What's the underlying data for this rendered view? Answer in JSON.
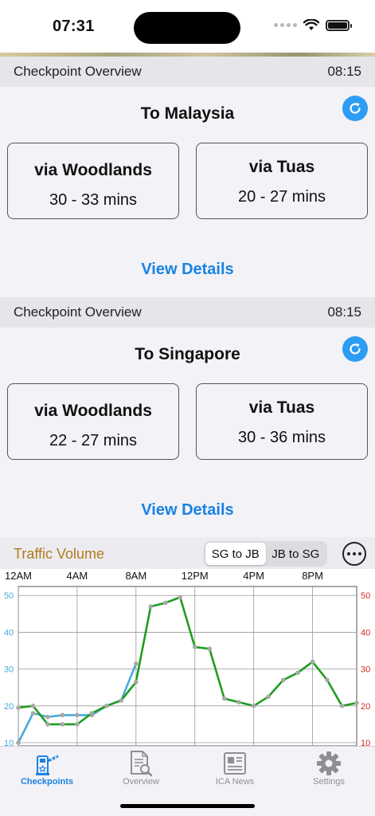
{
  "status": {
    "time": "07:31"
  },
  "to_malaysia": {
    "header_label": "Checkpoint Overview",
    "header_time": "08:15",
    "title": "To Malaysia",
    "woodlands": {
      "label": "via Woodlands",
      "time": "30 - 33 mins"
    },
    "tuas": {
      "label": "via Tuas",
      "time": "20 - 27 mins"
    },
    "view_details": "View Details"
  },
  "to_singapore": {
    "header_label": "Checkpoint Overview",
    "header_time": "08:15",
    "title": "To Singapore",
    "woodlands": {
      "label": "via Woodlands",
      "time": "22 - 27 mins"
    },
    "tuas": {
      "label": "via Tuas",
      "time": "30 - 36 mins"
    },
    "view_details": "View Details"
  },
  "traffic": {
    "title": "Traffic Volume",
    "toggle": [
      "SG to JB",
      "JB to SG"
    ],
    "selected": "SG to JB"
  },
  "chart_data": {
    "type": "line",
    "x_tick_labels": [
      "12AM",
      "4AM",
      "8AM",
      "12PM",
      "4PM",
      "8PM"
    ],
    "x_ticks_hours": [
      0,
      4,
      8,
      12,
      16,
      20
    ],
    "xlim": [
      0,
      23
    ],
    "y_left_ticks": [
      10,
      20,
      30,
      40,
      50
    ],
    "y_right_ticks": [
      10,
      20,
      30,
      40,
      50
    ],
    "ylim": [
      10,
      52
    ],
    "grid": true,
    "colors": {
      "left_axis": "#4aa9db",
      "right_axis": "#d62828"
    },
    "series": [
      {
        "color": "#4aa9db",
        "x": [
          0,
          1,
          2,
          3,
          4,
          5,
          6,
          7,
          8
        ],
        "values": [
          10,
          18,
          17,
          17.5,
          17.5,
          17.5,
          20,
          21.5,
          31.5
        ]
      },
      {
        "color": "#1e9e1e",
        "x": [
          0,
          1,
          2,
          3,
          4,
          5,
          6,
          7,
          8,
          9,
          10,
          11,
          12,
          13,
          14,
          15,
          16,
          17,
          18,
          19,
          20,
          21,
          22,
          23
        ],
        "values": [
          19.5,
          20,
          15,
          15,
          15,
          18,
          20,
          21.5,
          26.5,
          47,
          48,
          49.5,
          36,
          35.5,
          22,
          21,
          20,
          22.5,
          27,
          29,
          32,
          27,
          20,
          20.8
        ]
      }
    ]
  },
  "tabs": [
    {
      "label": "Checkpoints",
      "icon": "checkpoint-icon",
      "active": true
    },
    {
      "label": "Overview",
      "icon": "document-search-icon",
      "active": false
    },
    {
      "label": "ICA News",
      "icon": "newspaper-icon",
      "active": false
    },
    {
      "label": "Settings",
      "icon": "gear-icon",
      "active": false
    }
  ]
}
